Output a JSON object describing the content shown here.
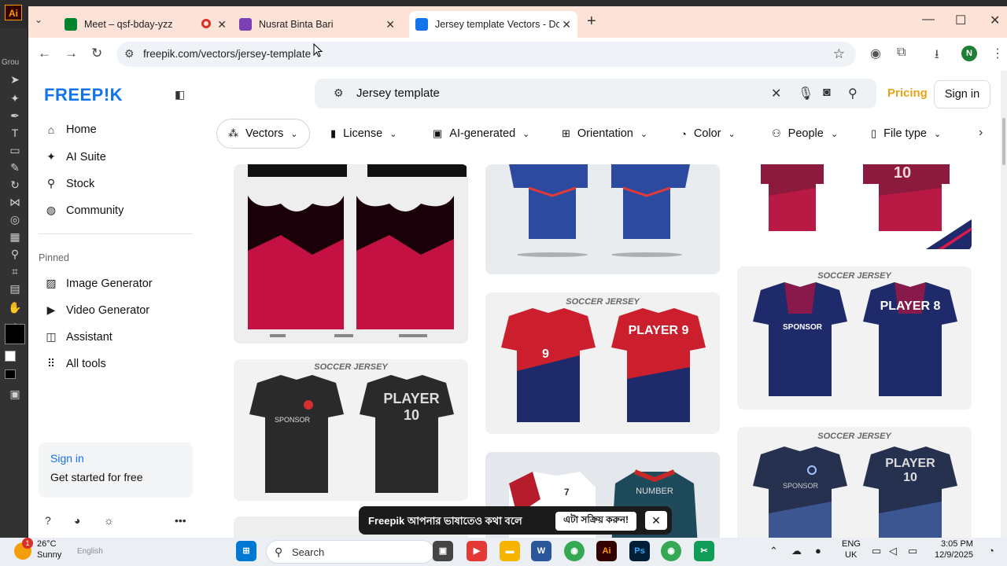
{
  "colors": {
    "brand": "#1273eb",
    "pricing": "#e8a317",
    "tabbar": "#fde2d7",
    "illustrator": "#ff9a00"
  },
  "illustrator": {
    "app_logo": "Ai",
    "workspace_label": "Grou"
  },
  "browser": {
    "tabs": [
      {
        "title": "Meet – qsf-bday-yzz",
        "icon": "google-meet-icon",
        "active": false
      },
      {
        "title": "Nusrat Binta Bari",
        "icon": "profile-page-icon",
        "active": false
      },
      {
        "title": "Jersey template Vectors - Down",
        "icon": "freepik-icon",
        "active": true
      }
    ],
    "url": "freepik.com/vectors/jersey-template",
    "profile_initial": "N"
  },
  "page": {
    "logo": "FREEP!K",
    "sidebar": {
      "main_items": [
        {
          "label": "Home",
          "icon": "home-icon"
        },
        {
          "label": "AI Suite",
          "icon": "sparkle-icon"
        },
        {
          "label": "Stock",
          "icon": "search-icon"
        },
        {
          "label": "Community",
          "icon": "globe-icon"
        }
      ],
      "pinned_label": "Pinned",
      "pinned_items": [
        {
          "label": "Image Generator",
          "icon": "image-icon"
        },
        {
          "label": "Video Generator",
          "icon": "video-icon"
        },
        {
          "label": "Assistant",
          "icon": "chat-icon"
        },
        {
          "label": "All tools",
          "icon": "grid-icon"
        }
      ],
      "signin_card": {
        "link": "Sign in",
        "text": "Get started for free"
      }
    },
    "search": {
      "query": "Jersey template"
    },
    "header": {
      "pricing": "Pricing",
      "sign_in": "Sign in"
    },
    "filters": [
      {
        "label": "Vectors",
        "icon": "vectors-icon"
      },
      {
        "label": "License",
        "icon": "license-icon"
      },
      {
        "label": "AI-generated",
        "icon": "ai-icon"
      },
      {
        "label": "Orientation",
        "icon": "orientation-icon"
      },
      {
        "label": "Color",
        "icon": "palette-icon"
      },
      {
        "label": "People",
        "icon": "people-icon"
      },
      {
        "label": "File type",
        "icon": "file-icon"
      }
    ],
    "results": [
      {
        "heading": "",
        "left_text": "",
        "right_text": "",
        "kind": "vest"
      },
      {
        "heading": "SOCCER JERSEY",
        "left_text": "SPONSOR",
        "right_text": "PLAYER 10",
        "kind": "black"
      },
      {
        "heading": "",
        "left_text": "",
        "right_text": "",
        "kind": "bluepattern"
      },
      {
        "heading": "SOCCER JERSEY",
        "left_text": "9",
        "right_text": "PLAYER 9",
        "kind": "redblue"
      },
      {
        "heading": "",
        "left_text": "7",
        "right_text": "NUMBER",
        "kind": "whitered"
      },
      {
        "heading": "",
        "left_text": "",
        "right_text": "10",
        "kind": "redpattern"
      },
      {
        "heading": "SOCCER JERSEY",
        "left_text": "SPONSOR",
        "right_text": "PLAYER 8",
        "kind": "navy"
      },
      {
        "heading": "SOCCER JERSEY",
        "left_text": "SPONSOR",
        "right_text": "PLAYER 10",
        "kind": "cracked"
      }
    ],
    "toast": {
      "text": "Freepik আপনার ভাষাতেও কথা বলে",
      "button": "এটা সক্রিয় করুন!"
    }
  },
  "taskbar": {
    "weather_temp": "26°C",
    "weather_cond": "Sunny",
    "notif_count": "1",
    "search_placeholder": "Search",
    "ghost_label": "English",
    "lang_line1": "ENG",
    "lang_line2": "UK",
    "time": "3:05 PM",
    "date": "12/9/2025"
  }
}
